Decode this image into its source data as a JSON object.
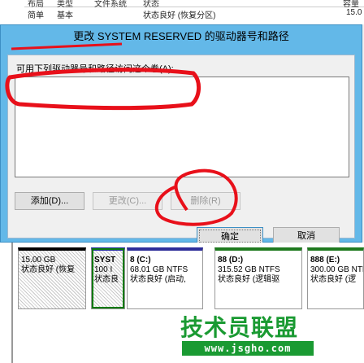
{
  "background_table": {
    "headers": [
      "布局",
      "类型",
      "文件系统",
      "状态",
      "容量"
    ],
    "row": {
      "layout": "简单",
      "type": "基本",
      "status": "状态良好 (恢复分区)",
      "capacity": "15.0"
    }
  },
  "dialog": {
    "title": "更改 SYSTEM RESERVED 的驱动器号和路径",
    "access_label": "可用下列驱动器号和路径访问这个卷(A):",
    "buttons": {
      "add": "添加(D)...",
      "change": "更改(C)...",
      "remove": "删除(R)",
      "ok": "确定",
      "cancel": "取消"
    }
  },
  "disk_map": {
    "segments": [
      {
        "lines": [
          "15.00 GB",
          "状态良好 (恢复"
        ]
      },
      {
        "lines": [
          "SYST",
          "100 I",
          "状态良"
        ]
      },
      {
        "lines": [
          "8  (C:)",
          "68.01 GB NTFS",
          "状态良好 (启动,"
        ]
      },
      {
        "lines": [
          "88  (D:)",
          "315.52 GB NTFS",
          "状态良好 (逻辑驱"
        ]
      },
      {
        "lines": [
          "888  (E:)",
          "300.00 GB NTFS",
          "状态良好 (逻"
        ]
      }
    ]
  },
  "watermark": {
    "logo": "技术员联盟",
    "url": "www.jsgho.com"
  },
  "colors": {
    "title_bar": "#63b8e8",
    "annotation_red": "#e8101a",
    "watermark_green": "#1a9a32",
    "partition_primary": "#1f2a9c"
  }
}
